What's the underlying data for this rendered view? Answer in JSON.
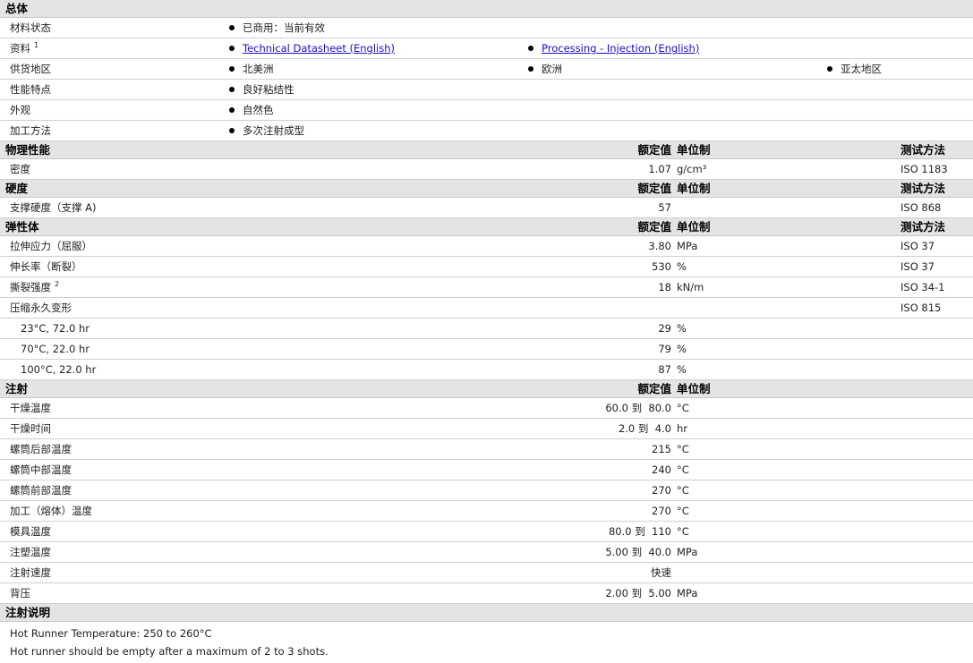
{
  "general": {
    "title": "总体",
    "rows": [
      {
        "label": "材料状态",
        "items": [
          "已商用：当前有效"
        ]
      },
      {
        "label": "资料",
        "sup": "1",
        "links": [
          "Technical Datasheet (English)",
          "Processing - Injection (English)"
        ]
      },
      {
        "label": "供货地区",
        "items": [
          "北美洲",
          "欧洲",
          "亚太地区"
        ]
      },
      {
        "label": "性能特点",
        "items": [
          "良好粘结性"
        ]
      },
      {
        "label": "外观",
        "items": [
          "自然色"
        ]
      },
      {
        "label": "加工方法",
        "items": [
          "多次注射成型"
        ]
      }
    ]
  },
  "headers": {
    "nominal": "额定值",
    "unit": "单位制",
    "test": "测试方法"
  },
  "physical": {
    "title": "物理性能",
    "rows": [
      {
        "label": "密度",
        "value": "1.07",
        "unit": "g/cm³",
        "test": "ISO 1183"
      }
    ]
  },
  "hardness": {
    "title": "硬度",
    "rows": [
      {
        "label": "支撑硬度（支撑 A)",
        "value": "57",
        "unit": "",
        "test": "ISO 868"
      }
    ]
  },
  "elastomer": {
    "title": "弹性体",
    "rows": [
      {
        "label": "拉伸应力（屈服）",
        "value": "3.80",
        "unit": "MPa",
        "test": "ISO 37"
      },
      {
        "label": "伸长率（断裂）",
        "value": "530",
        "unit": "%",
        "test": "ISO 37"
      },
      {
        "label": "撕裂强度",
        "sup": "2",
        "value": "18",
        "unit": "kN/m",
        "test": "ISO 34-1"
      },
      {
        "label": "压缩永久变形",
        "value": "",
        "unit": "",
        "test": "ISO 815"
      },
      {
        "label": "23°C, 72.0 hr",
        "value": "29",
        "unit": "%",
        "test": ""
      },
      {
        "label": "70°C, 22.0 hr",
        "value": "79",
        "unit": "%",
        "test": ""
      },
      {
        "label": "100°C, 22.0 hr",
        "value": "87",
        "unit": "%",
        "test": ""
      }
    ]
  },
  "injection": {
    "title": "注射",
    "rows": [
      {
        "label": "干燥温度",
        "value": "60.0 到  80.0",
        "unit": "°C"
      },
      {
        "label": "干燥时间",
        "value": "2.0 到  4.0",
        "unit": "hr"
      },
      {
        "label": "螺筒后部温度",
        "value": "215",
        "unit": "°C"
      },
      {
        "label": "螺筒中部温度",
        "value": "240",
        "unit": "°C"
      },
      {
        "label": "螺筒前部温度",
        "value": "270",
        "unit": "°C"
      },
      {
        "label": "加工（熔体）温度",
        "value": "270",
        "unit": "°C"
      },
      {
        "label": "模具温度",
        "value": "80.0 到  110",
        "unit": "°C"
      },
      {
        "label": "注塑温度",
        "value": "5.00 到  40.0",
        "unit": "MPa"
      },
      {
        "label": "注射速度",
        "value": "快速",
        "unit": ""
      },
      {
        "label": "背压",
        "value": "2.00 到  5.00",
        "unit": "MPa"
      }
    ]
  },
  "notes": {
    "title": "注射说明",
    "lines": [
      "Hot Runner Temperature: 250 to 260°C",
      "Hot runner should be empty after a maximum of 2 to 3 shots."
    ]
  }
}
